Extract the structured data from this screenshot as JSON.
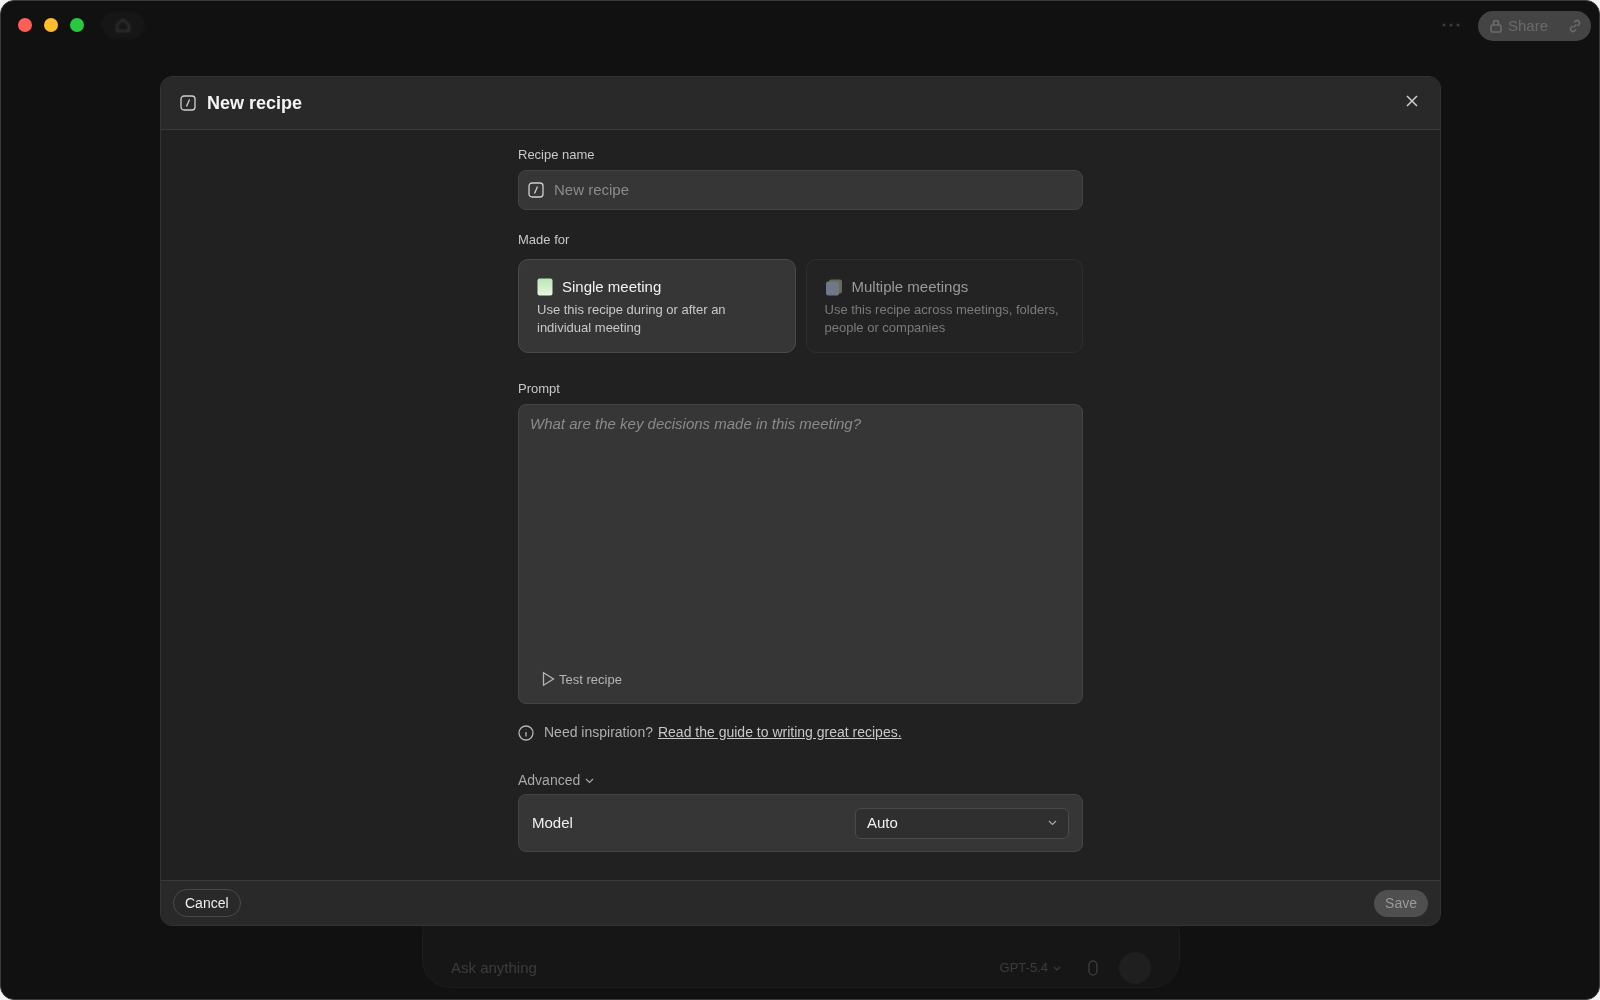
{
  "window": {
    "traffic_lights": [
      {
        "color": "#ff5f57"
      },
      {
        "color": "#febc2e"
      },
      {
        "color": "#28c840"
      }
    ]
  },
  "background": {
    "share_button": "Share",
    "chat": {
      "placeholder": "Ask anything",
      "model": "GPT-5.4"
    }
  },
  "dialog": {
    "title": "New recipe",
    "recipe_name": {
      "label": "Recipe name",
      "placeholder": "New recipe"
    },
    "made_for": {
      "label": "Made for",
      "options": [
        {
          "title": "Single meeting",
          "description": "Use this recipe during or after an individual meeting",
          "selected": true
        },
        {
          "title": "Multiple meetings",
          "description": "Use this recipe across meetings, folders, people or companies",
          "selected": false
        }
      ]
    },
    "prompt": {
      "label": "Prompt",
      "placeholder": "What are the key decisions made in this meeting?",
      "test_button": "Test recipe"
    },
    "hint": {
      "text": "Need inspiration?",
      "link": "Read the guide to writing great recipes."
    },
    "advanced": {
      "label": "Advanced",
      "expanded": true,
      "model_label": "Model",
      "model_value": "Auto"
    },
    "buttons": {
      "cancel": "Cancel",
      "save": "Save",
      "save_disabled": true
    }
  }
}
